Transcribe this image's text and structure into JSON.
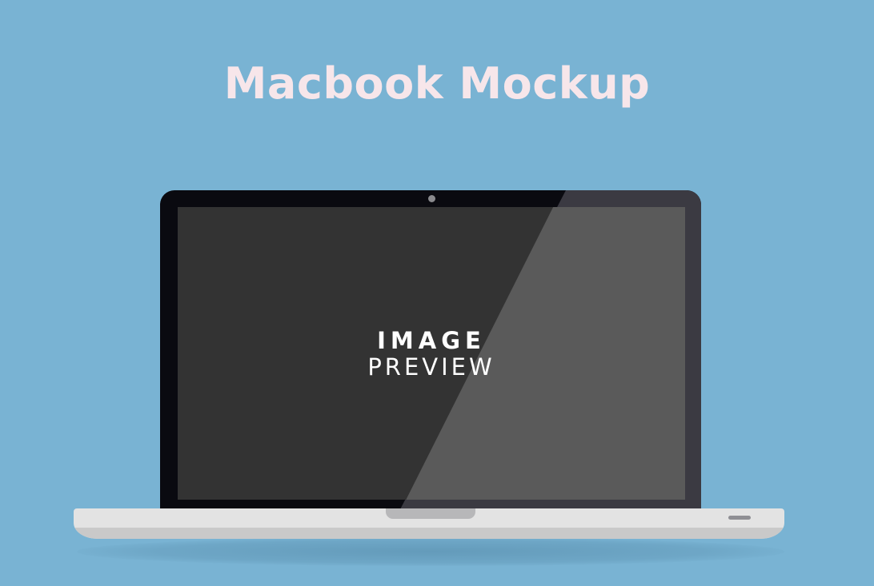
{
  "title": "Macbook Mockup",
  "screen": {
    "line1": "IMAGE",
    "line2": "PREVIEW"
  },
  "colors": {
    "background": "#79b3d3",
    "title": "#f7e6ea",
    "bezel": "#0a0a10",
    "screen": "#333333",
    "screen_glare": "#5a5a5a",
    "base": "#e3e3e3"
  },
  "icons": [
    "camera-icon",
    "trackpad-notch-icon",
    "port-icon"
  ]
}
